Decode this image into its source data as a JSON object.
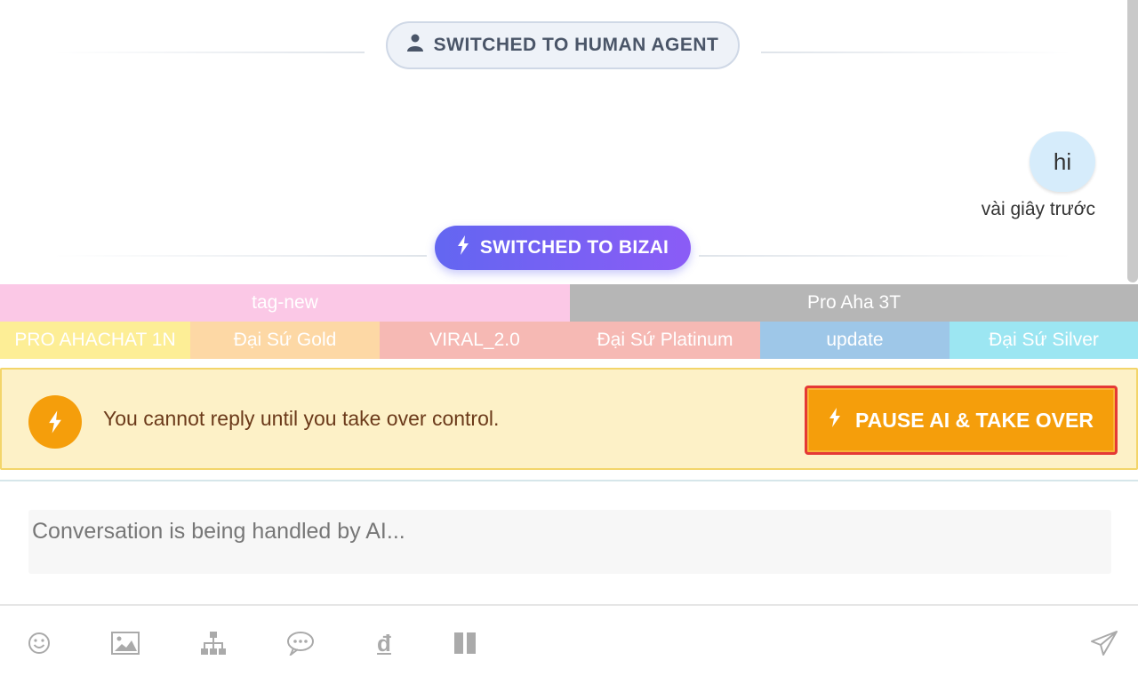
{
  "chat": {
    "system_messages": {
      "human": "SWITCHED TO HUMAN AGENT",
      "bizai": "SWITCHED TO BIZAI"
    },
    "message": {
      "text": "hi",
      "time": "vài giây trước"
    }
  },
  "tags": {
    "row1": [
      {
        "label": "tag-new",
        "color": "#fbc8e6"
      },
      {
        "label": "Pro Aha 3T",
        "color": "#b6b6b6"
      }
    ],
    "row2": [
      {
        "label": "PRO AHACHAT 1N",
        "color": "#fdee96"
      },
      {
        "label": "Đại Sứ Gold",
        "color": "#fdd8a5"
      },
      {
        "label": "VIRAL_2.0",
        "color": "#f6b9b4"
      },
      {
        "label": "Đại Sứ Platinum",
        "color": "#f6b9b4"
      },
      {
        "label": "update",
        "color": "#9ec7e8"
      },
      {
        "label": "Đại Sứ Silver",
        "color": "#9ce6f2"
      }
    ]
  },
  "warning": {
    "text": "You cannot reply until you take over control.",
    "button_label": "PAUSE AI & TAKE OVER"
  },
  "composer": {
    "placeholder": "Conversation is being handled by AI..."
  },
  "toolbar": {
    "icons": [
      "emoji-icon",
      "image-icon",
      "sitemap-icon",
      "comment-dots-icon",
      "currency-dong-icon",
      "pause-icon",
      "send-icon"
    ],
    "currency_symbol": "đ"
  },
  "colors": {
    "accent_orange": "#f59e0b",
    "bizai_gradient_start": "#6366f1",
    "bizai_gradient_end": "#8b5cf6",
    "warning_bg": "#fdf1c7",
    "highlight_border": "#e53935"
  }
}
